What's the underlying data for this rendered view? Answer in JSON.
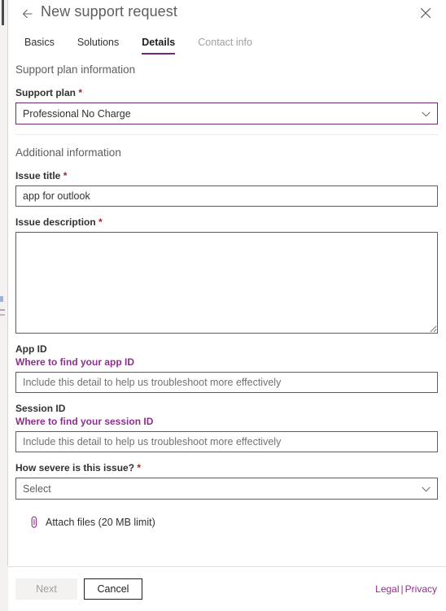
{
  "header": {
    "title": "New support request",
    "back_icon": "arrow-left-icon",
    "close_icon": "close-icon"
  },
  "tabs": [
    {
      "label": "Basics",
      "state": "normal"
    },
    {
      "label": "Solutions",
      "state": "normal"
    },
    {
      "label": "Details",
      "state": "active"
    },
    {
      "label": "Contact info",
      "state": "muted"
    }
  ],
  "sections": {
    "support_plan": {
      "heading": "Support plan information",
      "plan_label": "Support plan",
      "plan_required": "*",
      "plan_value": "Professional No Charge",
      "chevron_icon": "chevron-down-icon"
    },
    "additional": {
      "heading": "Additional information",
      "issue_title_label": "Issue title",
      "issue_title_required": "*",
      "issue_title_value": "app for outlook",
      "issue_desc_label": "Issue description",
      "issue_desc_required": "*",
      "issue_desc_value": "",
      "app_id_label": "App ID",
      "app_id_link": "Where to find your app ID",
      "app_id_placeholder": "Include this detail to help us troubleshoot more effectively",
      "app_id_value": "",
      "session_id_label": "Session ID",
      "session_id_link": "Where to find your session ID",
      "session_id_placeholder": "Include this detail to help us troubleshoot more effectively",
      "session_id_value": "",
      "severity_label": "How severe is this issue?",
      "severity_required": "*",
      "severity_value": "Select",
      "attach_label": "Attach files (20 MB limit)",
      "attach_icon": "paperclip-icon"
    }
  },
  "footer": {
    "next_label": "Next",
    "cancel_label": "Cancel",
    "legal_label": "Legal",
    "legal_separator": "|",
    "privacy_label": "Privacy"
  },
  "colors": {
    "accent_purple": "#742774",
    "link_purple": "#8d2f8d",
    "required_red": "#a4262c",
    "border_gray": "#605e5c",
    "divider_gray": "#edebe9"
  }
}
